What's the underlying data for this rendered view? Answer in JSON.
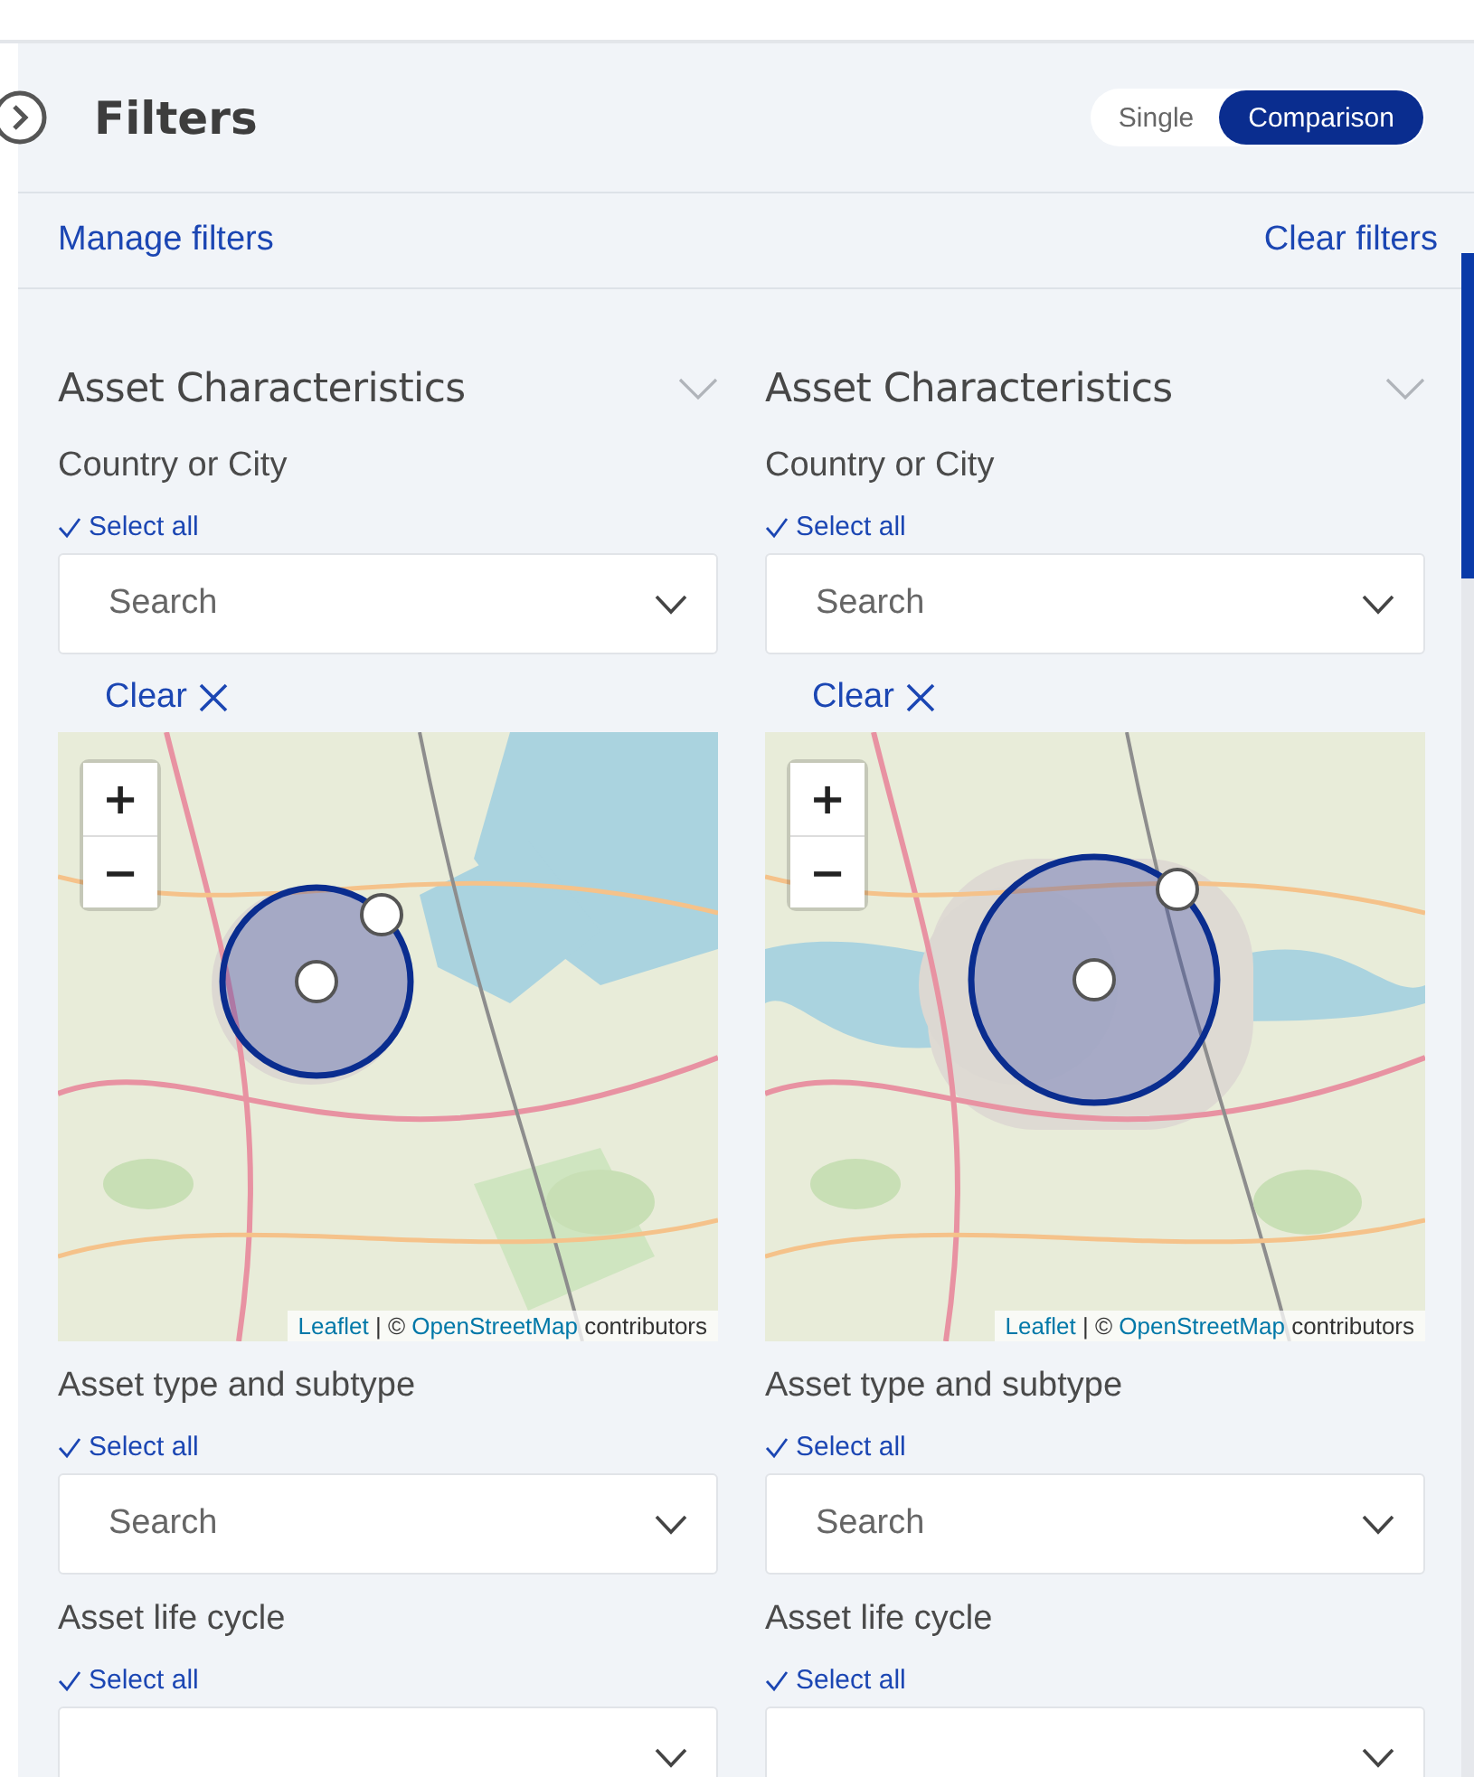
{
  "panel": {
    "title": "Filters"
  },
  "mode_toggle": [
    {
      "label": "Single",
      "selected": false
    },
    {
      "label": "Comparison",
      "selected": true
    }
  ],
  "links": {
    "manage": "Manage filters",
    "clear": "Clear filters"
  },
  "columns": [
    {
      "section": {
        "title": "Asset Characteristics",
        "expanded": true
      },
      "filters": [
        {
          "label": "Country or City",
          "select_all": "Select all",
          "placeholder": "Search",
          "clear": "Clear",
          "map": {
            "kind": "picture",
            "zoom_in": "+",
            "zoom_out": "−",
            "attribution": {
              "leaflet": "Leaflet",
              "separator": "| ©",
              "osm": "OpenStreetMap",
              "tail": "contributors"
            }
          }
        },
        {
          "label": "Asset type and subtype",
          "select_all": "Select all",
          "placeholder": "Search"
        },
        {
          "label": "Asset life cycle",
          "select_all": "Select all"
        }
      ]
    },
    {
      "section": {
        "title": "Asset Characteristics",
        "expanded": true
      },
      "filters": [
        {
          "label": "Country or City",
          "select_all": "Select all",
          "placeholder": "Search",
          "clear": "Clear",
          "map": {
            "kind": "picture",
            "zoom_in": "+",
            "zoom_out": "−",
            "attribution": {
              "leaflet": "Leaflet",
              "separator": "| ©",
              "osm": "OpenStreetMap",
              "tail": "contributors"
            }
          }
        },
        {
          "label": "Asset type and subtype",
          "select_all": "Select all",
          "placeholder": "Search"
        },
        {
          "label": "Asset life cycle",
          "select_all": "Select all"
        }
      ]
    }
  ]
}
